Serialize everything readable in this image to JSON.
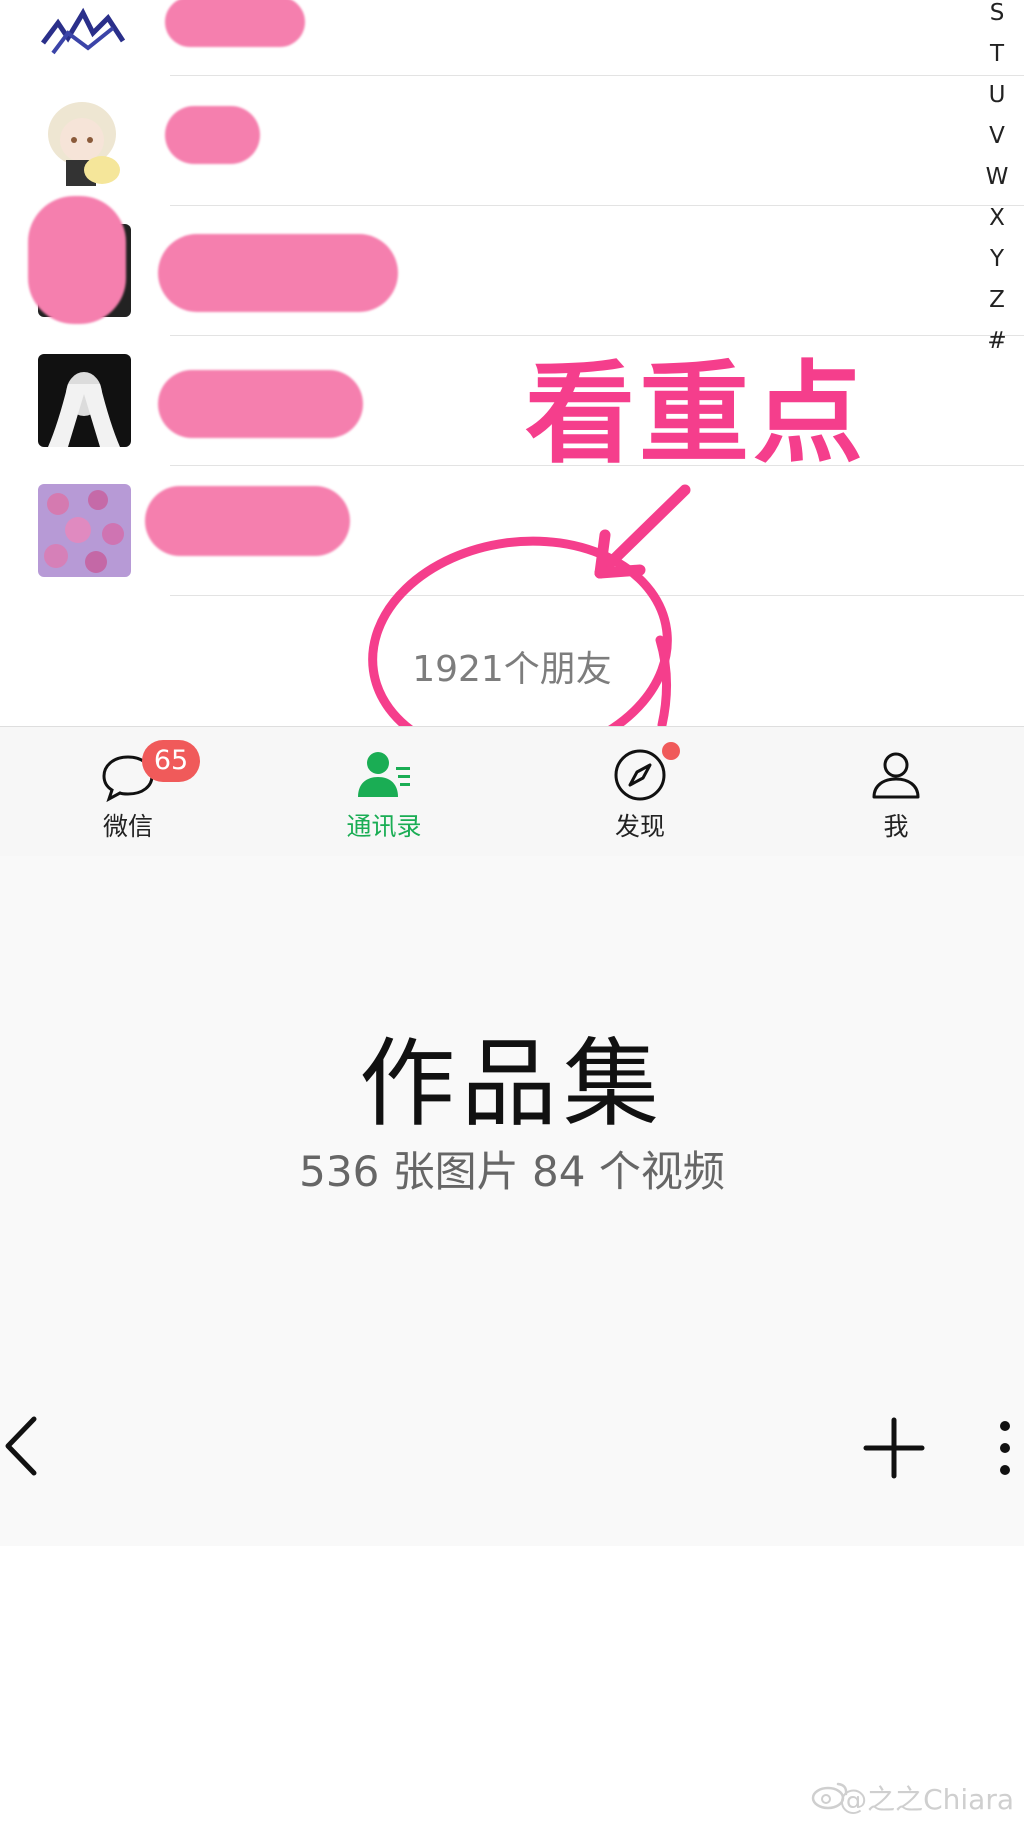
{
  "alpha_index": [
    "S",
    "T",
    "U",
    "V",
    "W",
    "X",
    "Y",
    "Z",
    "#"
  ],
  "contacts_footer": {
    "friend_count": "1921个朋友"
  },
  "annotation": {
    "text": "看重点",
    "color": "#f53e8c"
  },
  "tabbar": {
    "tabs": [
      {
        "label": "微信",
        "icon": "chat-bubble-icon",
        "badge": "65"
      },
      {
        "label": "通讯录",
        "icon": "contacts-icon",
        "active": true
      },
      {
        "label": "发现",
        "icon": "compass-icon",
        "dot": true
      },
      {
        "label": "我",
        "icon": "person-icon"
      }
    ],
    "active_color": "#1aad54",
    "badge_color": "#f05a5a"
  },
  "album": {
    "title": "作品集",
    "subtitle": "536 张图片 84 个视频"
  },
  "album_toolbar": {
    "back_icon": "chevron-left-icon",
    "add_icon": "plus-icon",
    "more_icon": "more-vertical-icon"
  },
  "watermark": {
    "text": "@之之Chiara",
    "icon": "weibo-logo-icon"
  }
}
